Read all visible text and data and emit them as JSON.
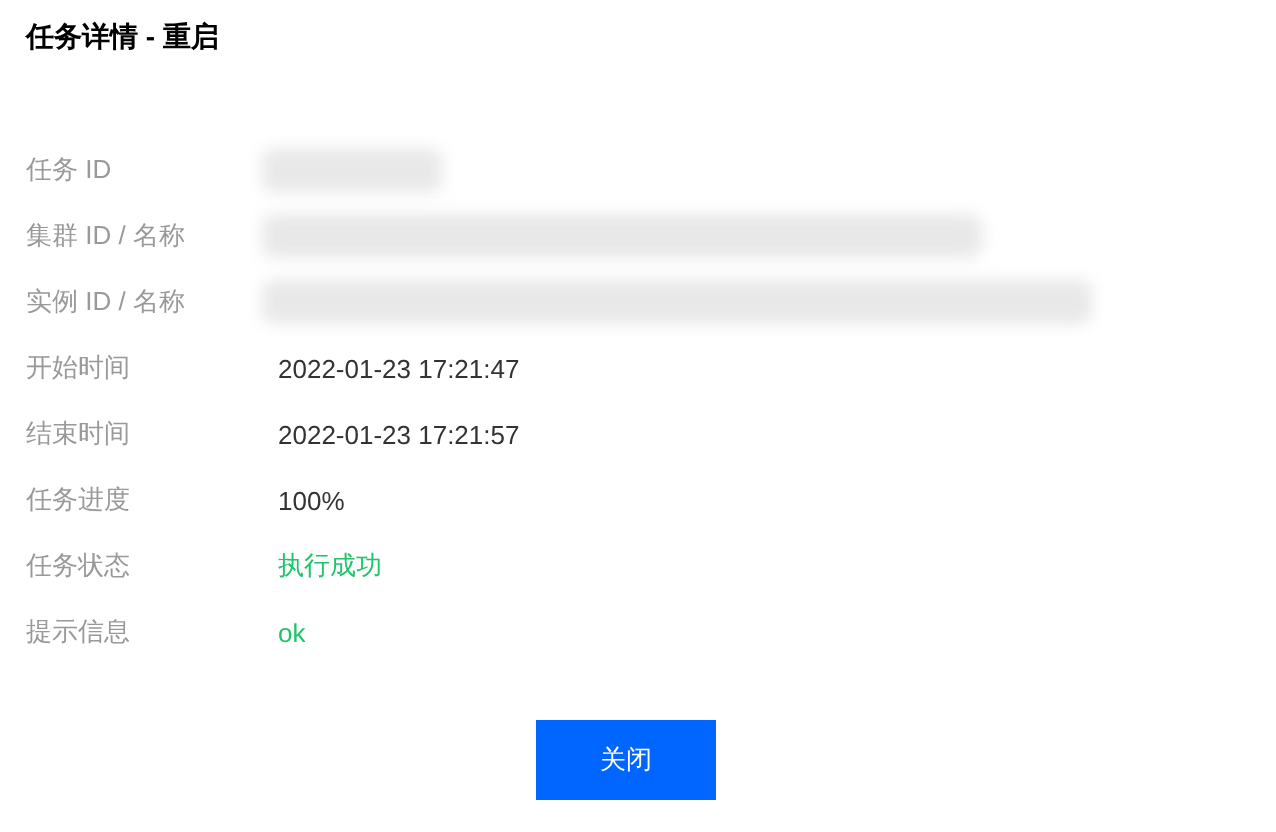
{
  "dialog": {
    "title": "任务详情 - 重启"
  },
  "fields": [
    {
      "label": "任务 ID",
      "kind": "redacted"
    },
    {
      "label": "集群 ID / 名称",
      "kind": "redacted"
    },
    {
      "label": "实例 ID / 名称",
      "kind": "redacted"
    },
    {
      "label": "开始时间",
      "kind": "text",
      "value": "2022-01-23 17:21:47"
    },
    {
      "label": "结束时间",
      "kind": "text",
      "value": "2022-01-23 17:21:57"
    },
    {
      "label": "任务进度",
      "kind": "text",
      "value": "100%"
    },
    {
      "label": "任务状态",
      "kind": "success",
      "value": "执行成功"
    },
    {
      "label": "提示信息",
      "kind": "success",
      "value": "ok"
    }
  ],
  "buttons": [
    {
      "label": "关闭"
    }
  ]
}
